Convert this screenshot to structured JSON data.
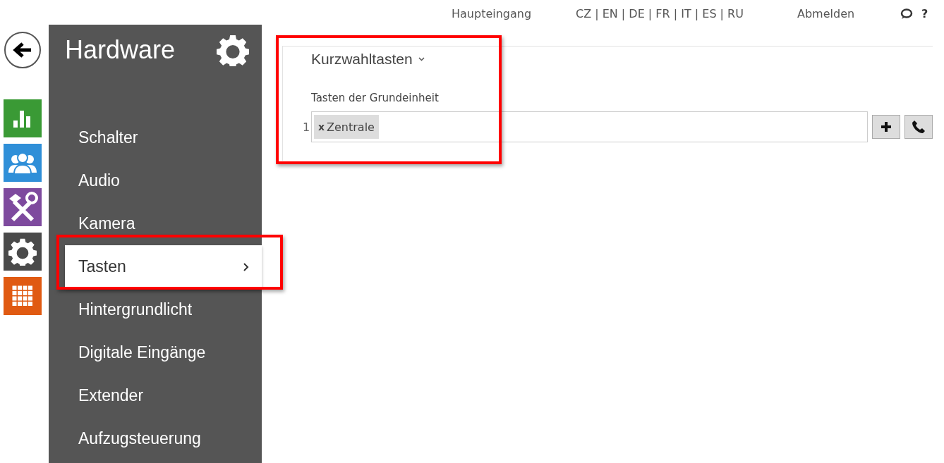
{
  "top_bar": {
    "location": "Haupteingang",
    "languages": "CZ | EN | DE | FR | IT | ES | RU",
    "logout": "Abmelden",
    "help": "?"
  },
  "nav_rail": [
    {
      "kind": "chart",
      "color": "#3a9a35"
    },
    {
      "kind": "users",
      "color": "#2f8fd8"
    },
    {
      "kind": "tools",
      "color": "#7e4a9e"
    },
    {
      "kind": "gear",
      "color": "#4a4a4a"
    },
    {
      "kind": "grid",
      "color": "#e05a12"
    }
  ],
  "sidebar": {
    "title": "Hardware",
    "items": [
      {
        "label": "Schalter",
        "selected": false
      },
      {
        "label": "Audio",
        "selected": false
      },
      {
        "label": "Kamera",
        "selected": false
      },
      {
        "label": "Tasten",
        "selected": true
      },
      {
        "label": "Hintergrundlicht",
        "selected": false
      },
      {
        "label": "Digitale Eingänge",
        "selected": false
      },
      {
        "label": "Extender",
        "selected": false
      },
      {
        "label": "Aufzugsteuerung",
        "selected": false
      }
    ]
  },
  "section": {
    "title": "Kurzwahltasten",
    "field_label": "Tasten der Grundeinheit",
    "rows": [
      {
        "number": "1",
        "tags": [
          {
            "remove": "x",
            "label": "Zentrale"
          }
        ]
      }
    ]
  }
}
